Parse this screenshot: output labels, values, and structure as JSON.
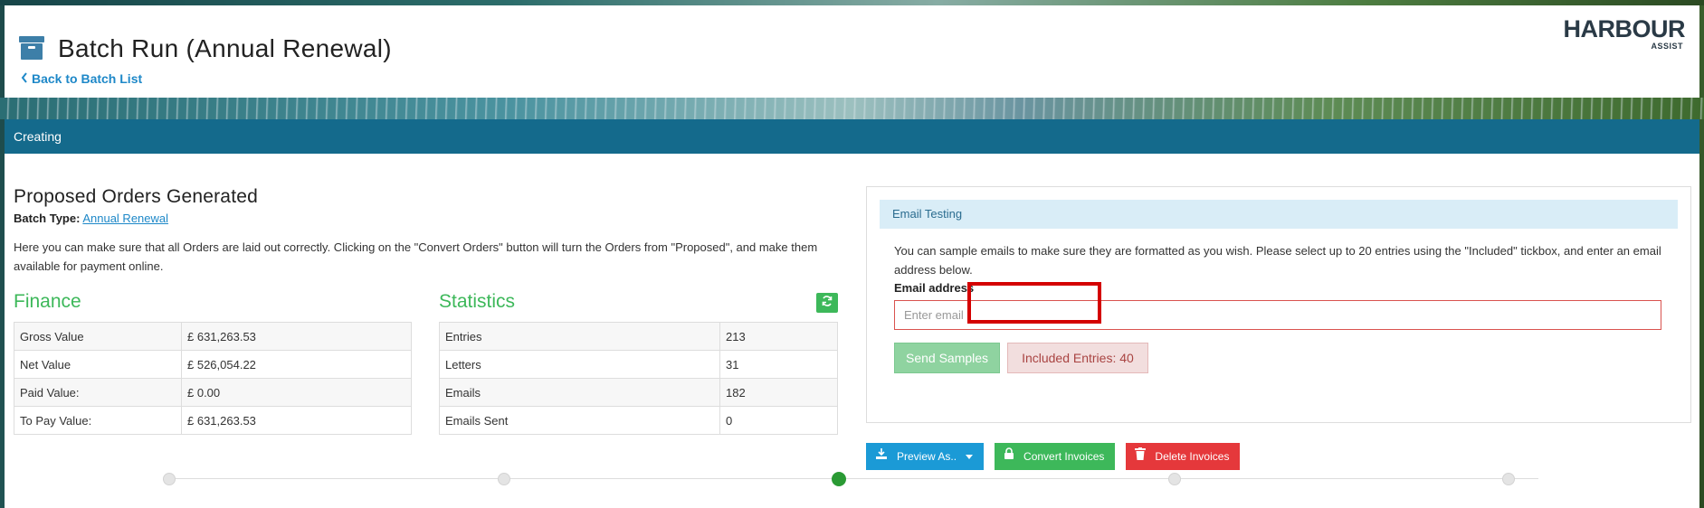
{
  "header": {
    "title": "Batch Run (Annual Renewal)",
    "back_label": "Back to Batch List",
    "logo_main": "HARBOUR",
    "logo_sub": "ASSIST"
  },
  "status": {
    "label": "Creating"
  },
  "summary": {
    "heading": "Proposed Orders Generated",
    "batch_type_label": "Batch Type:",
    "batch_type_value": "Annual Renewal",
    "description": "Here you can make sure that all Orders are laid out correctly. Clicking on the \"Convert Orders\" button will turn the Orders from \"Proposed\", and make them available for payment online."
  },
  "finance": {
    "title": "Finance",
    "rows": [
      {
        "label": "Gross Value",
        "value": "£ 631,263.53"
      },
      {
        "label": "Net Value",
        "value": "£ 526,054.22"
      },
      {
        "label": "Paid Value:",
        "value": "£ 0.00"
      },
      {
        "label": "To Pay Value:",
        "value": "£ 631,263.53"
      }
    ]
  },
  "statistics": {
    "title": "Statistics",
    "rows": [
      {
        "label": "Entries",
        "value": "213"
      },
      {
        "label": "Letters",
        "value": "31"
      },
      {
        "label": "Emails",
        "value": "182"
      },
      {
        "label": "Emails Sent",
        "value": "0"
      }
    ]
  },
  "email_testing": {
    "title": "Email Testing",
    "description": "You can sample emails to make sure they are formatted as you wish. Please select up to 20 entries using the \"Included\" tickbox, and enter an email address below.",
    "email_label": "Email address",
    "email_placeholder": "Enter email",
    "send_label": "Send Samples",
    "included_label": "Included Entries: 40"
  },
  "actions": {
    "preview_label": "Preview As..",
    "convert_label": "Convert Invoices",
    "delete_label": "Delete Invoices"
  },
  "stepper": {
    "active_step": 3,
    "step_count": 5
  },
  "colors": {
    "status_bar": "#146a8c",
    "accent_green": "#3db85a",
    "link_blue": "#1e88c8",
    "danger_red": "#e5383b",
    "preview_blue": "#1b9ad6",
    "highlight_red": "#d40000"
  }
}
